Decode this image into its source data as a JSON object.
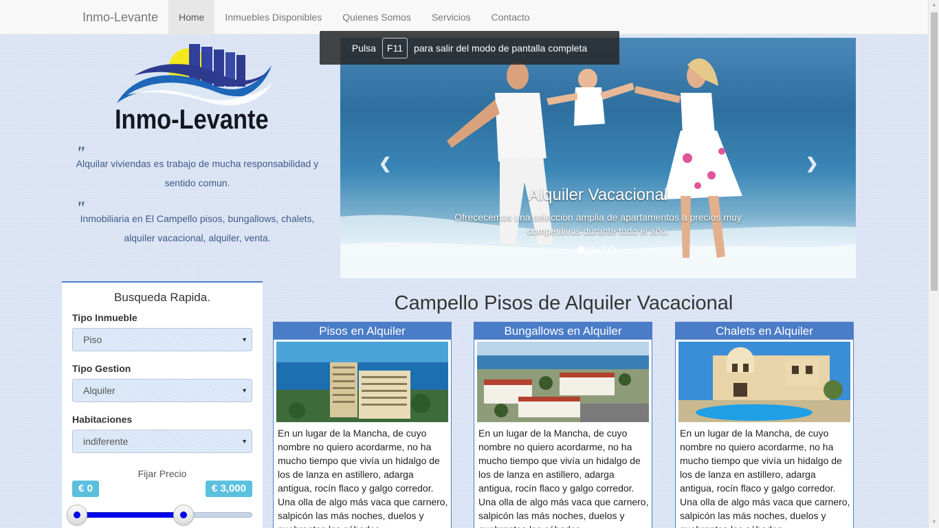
{
  "nav": {
    "brand": "Inmo-Levante",
    "items": [
      {
        "label": "Home",
        "active": true
      },
      {
        "label": "Inmuebles Disponibles",
        "active": false
      },
      {
        "label": "Quienes Somos",
        "active": false
      },
      {
        "label": "Servicios",
        "active": false
      },
      {
        "label": "Contacto",
        "active": false
      }
    ]
  },
  "fullscreen_notice": {
    "before": "Pulsa",
    "key": "F11",
    "after": "para salir del modo de pantalla completa"
  },
  "logo": {
    "text": "Inmo-Levante"
  },
  "quotes": [
    "Alquilar viviendas es trabajo de mucha responsabilidad y sentido comun.",
    "Inmobiliaria en El Campello pisos, bungallows, chalets, alquiler vacacional, alquiler, venta."
  ],
  "carousel": {
    "title": "Alquiler Vacacional",
    "text": "Ofrececemos una seleccion amplia de apartamentos a precios muy competitivos durante todo el año.",
    "prev_icon": "chevron-left-icon",
    "next_icon": "chevron-right-icon",
    "slide_count": 4,
    "active_slide": 1
  },
  "search": {
    "title": "Busqueda Rapida.",
    "fields": [
      {
        "label": "Tipo Inmueble",
        "value": "Piso"
      },
      {
        "label": "Tipo Gestion",
        "value": "Alquiler"
      },
      {
        "label": "Habitaciones",
        "value": "indiferente"
      }
    ],
    "price_label": "Fijar Precio",
    "price_min": "€ 0",
    "price_max": "€ 3,000"
  },
  "main_title": "Campello Pisos de Alquiler Vacacional",
  "cards": [
    {
      "title": "Pisos en Alquiler",
      "text": "En un lugar de la Mancha, de cuyo nombre no quiero acordarme, no ha mucho tiempo que vivía un hidalgo de los de lanza en astillero, adarga antigua, rocín flaco y galgo corredor. Una olla de algo más vaca que carnero, salpicón las más noches, duelos y quebrantos los sábados"
    },
    {
      "title": "Bungallows en Alquiler",
      "text": "En un lugar de la Mancha, de cuyo nombre no quiero acordarme, no ha mucho tiempo que vivía un hidalgo de los de lanza en astillero, adarga antigua, rocín flaco y galgo corredor. Una olla de algo más vaca que carnero, salpicón las más noches, duelos y quebrantos los sábados"
    },
    {
      "title": "Chalets en Alquiler",
      "text": "En un lugar de la Mancha, de cuyo nombre no quiero acordarme, no ha mucho tiempo que vivía un hidalgo de los de lanza en astillero, adarga antigua, rocín flaco y galgo corredor. Una olla de algo más vaca que carnero, salpicón las más noches, duelos y quebrantos los sábados"
    }
  ],
  "colors": {
    "accent": "#4a7cc7",
    "badge": "#5bc0de",
    "slider": "#0000ee"
  }
}
